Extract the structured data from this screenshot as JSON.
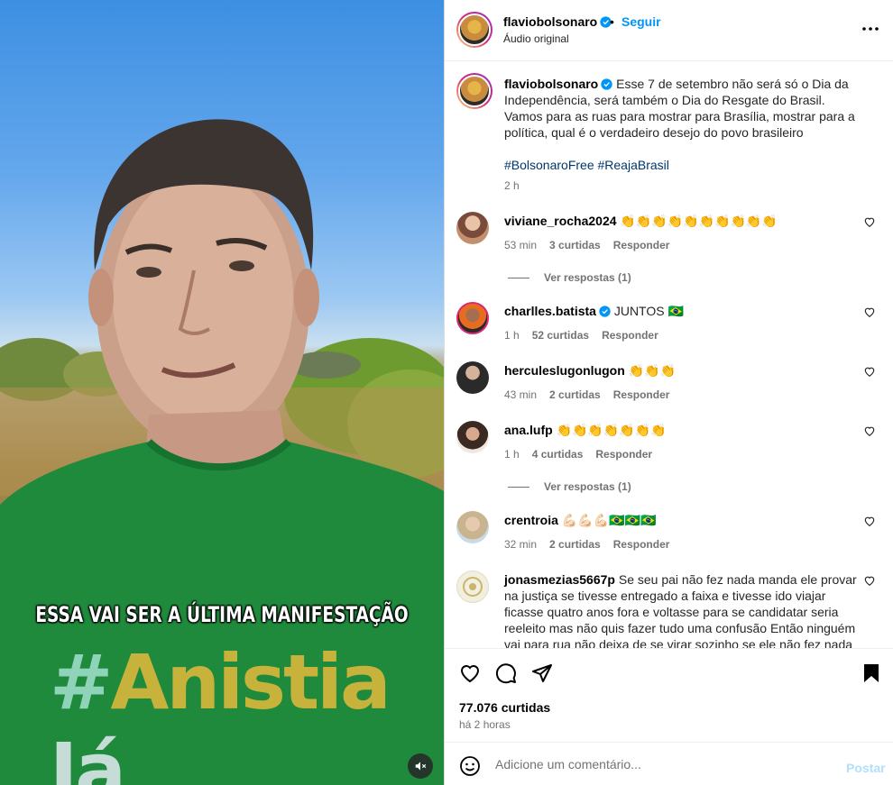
{
  "video": {
    "caption": "ESSA VAI SER A ÚLTIMA MANIFESTAÇÃO",
    "shirt_hash": "#",
    "shirt_word": "Anistia",
    "shirt_ja": "Já"
  },
  "header": {
    "username": "flaviobolsonaro",
    "dot": "•",
    "follow_label": "Seguir",
    "audio_label": "Áudio original"
  },
  "caption_post": {
    "username": "flaviobolsonaro",
    "text": "Esse 7 de setembro não será só o Dia da Independência, será também o Dia do Resgate do Brasil. Vamos para as ruas para mostrar para Brasília, mostrar para a política, qual é o verdadeiro desejo do povo brasileiro",
    "hashtags": "#BolsonaroFree #ReajaBrasil",
    "time": "2 h"
  },
  "comments": [
    {
      "username": "viviane_rocha2024",
      "text": "👏👏👏👏👏👏👏👏👏👏",
      "time": "53 min",
      "likes": "3 curtidas",
      "reply": "Responder",
      "replies_label": "Ver respostas (1)"
    },
    {
      "username": "charlles.batista",
      "text": "JUNTOS 🇧🇷",
      "time": "1 h",
      "likes": "52 curtidas",
      "reply": "Responder"
    },
    {
      "username": "herculeslugonlugon",
      "text": "👏👏👏",
      "time": "43 min",
      "likes": "2 curtidas",
      "reply": "Responder"
    },
    {
      "username": "ana.lufp",
      "text": "👏👏👏👏👏👏👏",
      "time": "1 h",
      "likes": "4 curtidas",
      "reply": "Responder",
      "replies_label": "Ver respostas (1)"
    },
    {
      "username": "crentroia",
      "text": "💪🏻💪🏻💪🏻🇧🇷🇧🇷🇧🇷",
      "time": "32 min",
      "likes": "2 curtidas",
      "reply": "Responder"
    },
    {
      "username": "jonasmezias5667p",
      "text": "Se seu pai não fez nada manda ele provar na justiça se tivesse entregado a faixa e tivesse ido viajar ficasse quatro anos fora e voltasse para se candidatar seria reeleito mas não quis fazer tudo uma confusão Então ninguém vai para rua não deixa de se virar sozinho se ele não fez nada"
    }
  ],
  "actions": {
    "likes": "77.076 curtidas",
    "time_ago": "há 2 horas"
  },
  "comment_bar": {
    "placeholder": "Adicione um comentário...",
    "post_label": "Postar"
  },
  "colors": {
    "accent": "#0095f6",
    "verified": "#0095f6",
    "hashtag": "#00376b",
    "muted": "#737373"
  }
}
